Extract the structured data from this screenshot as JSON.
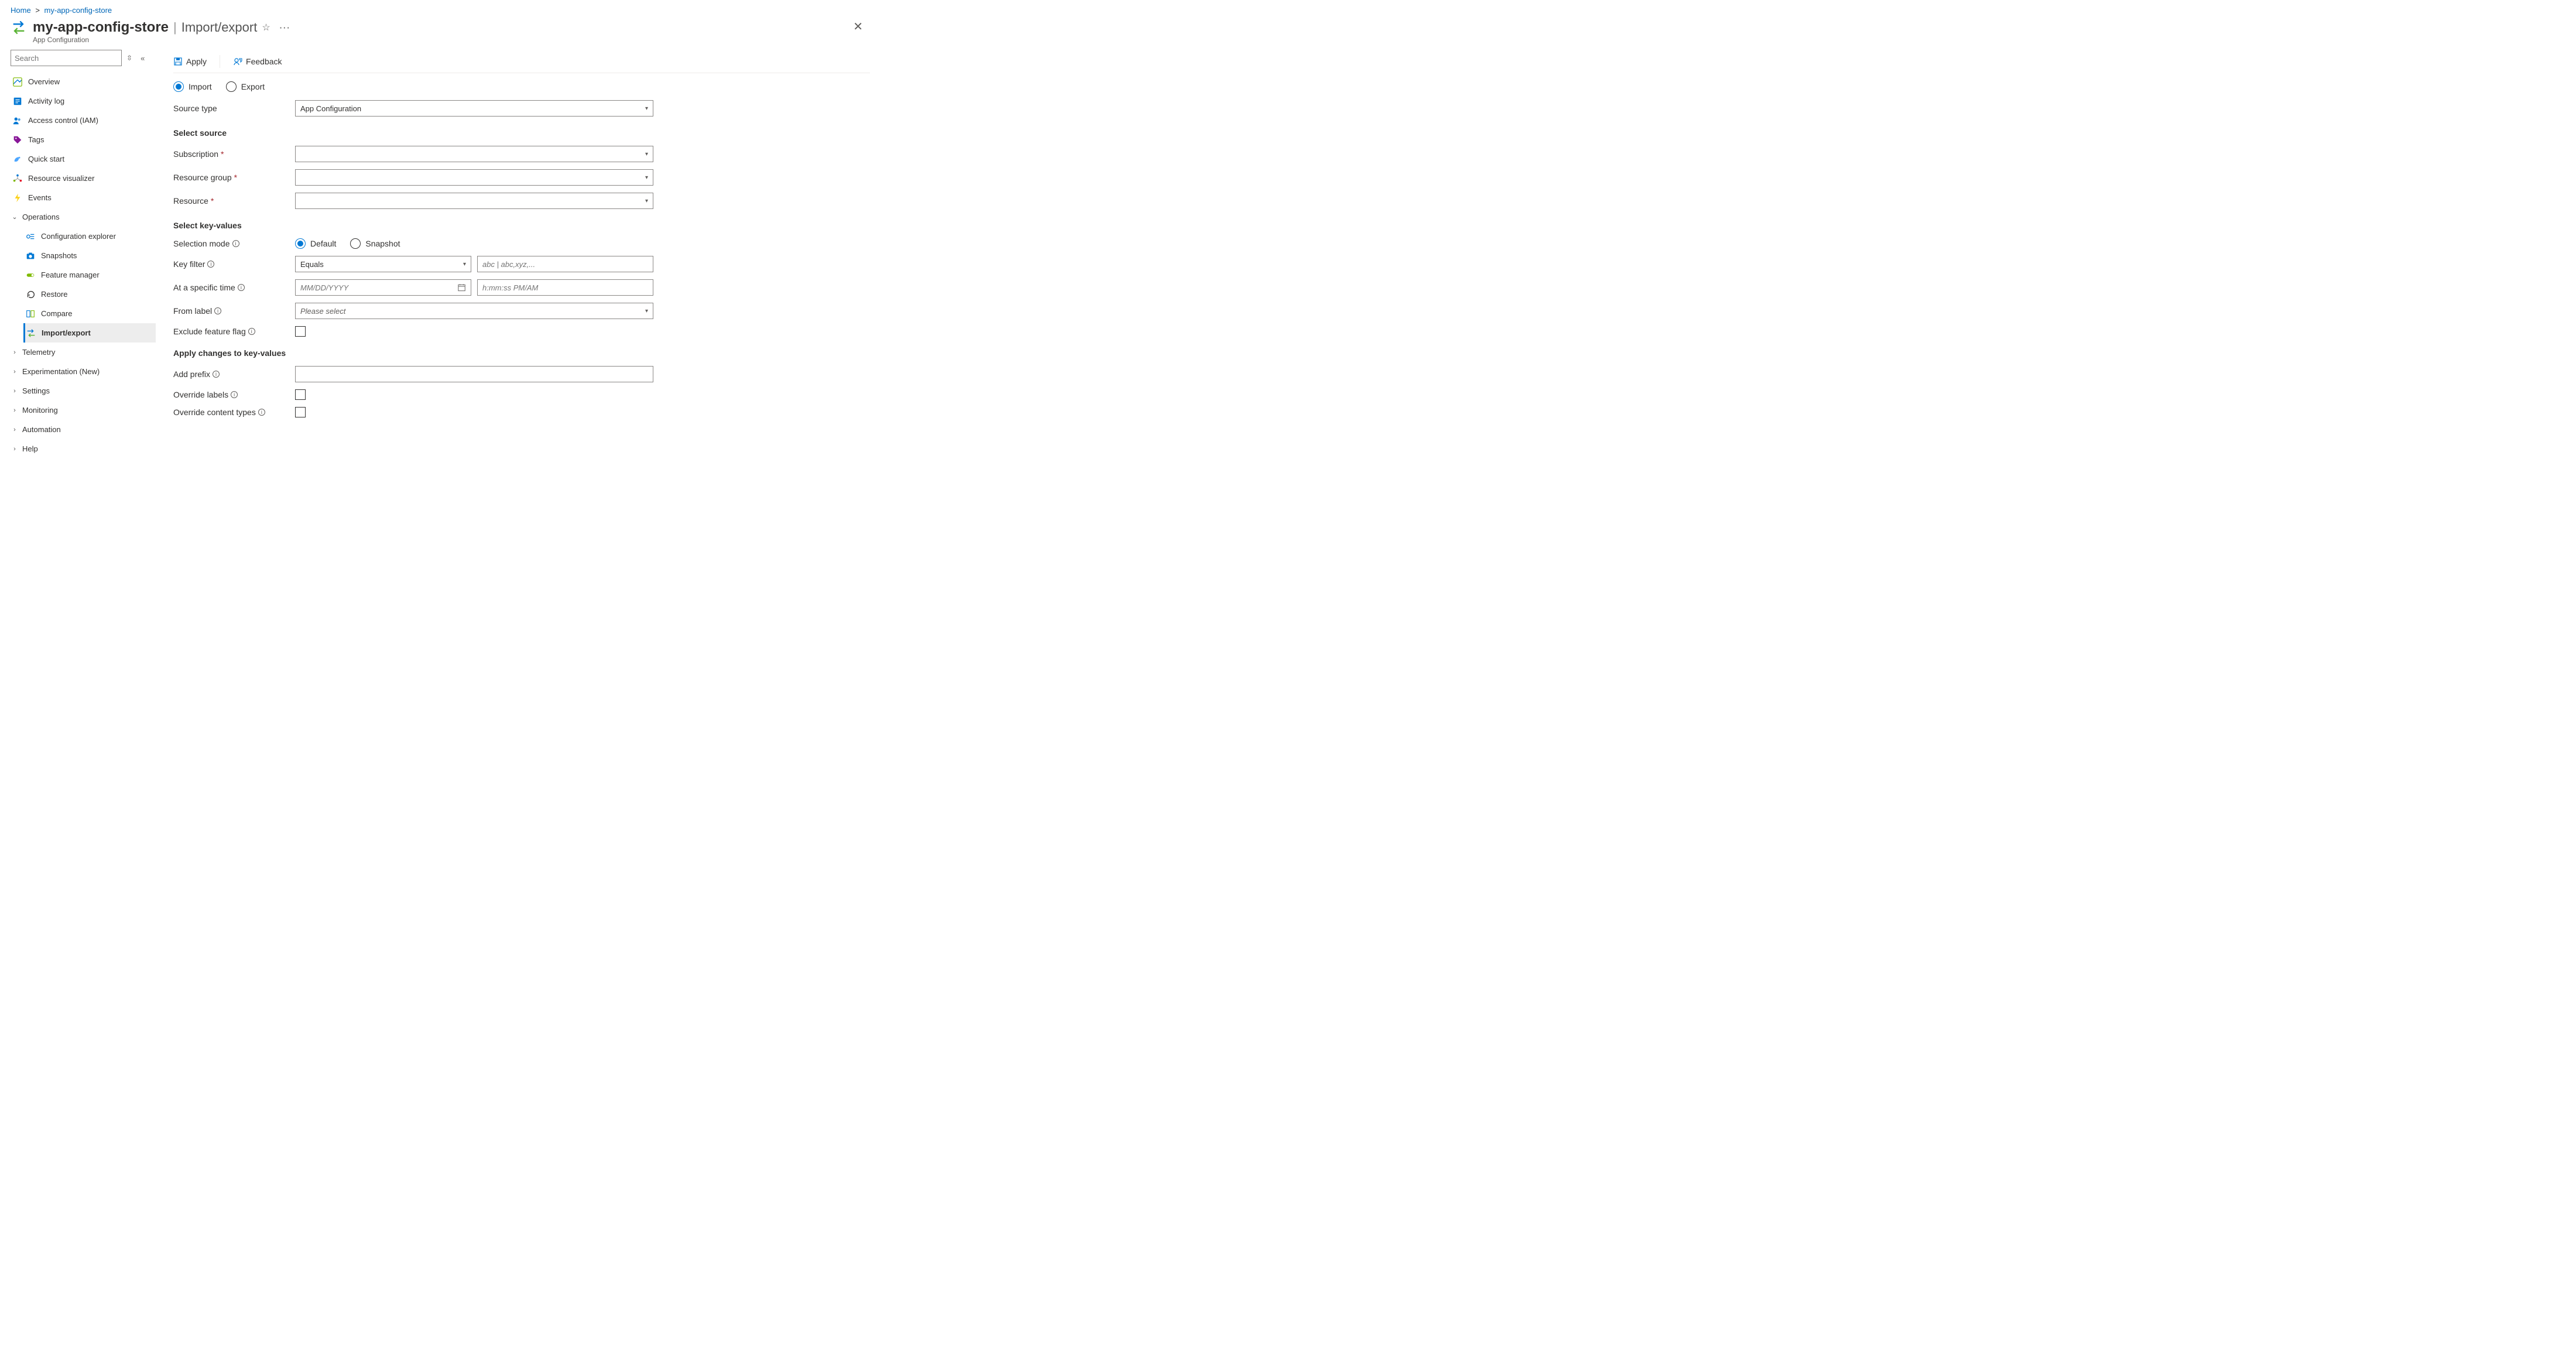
{
  "breadcrumb": {
    "home": "Home",
    "resource": "my-app-config-store"
  },
  "header": {
    "title": "my-app-config-store",
    "divider": "|",
    "page": "Import/export",
    "subtitle": "App Configuration",
    "star_aria": "Pin",
    "more_aria": "More",
    "close_aria": "Close"
  },
  "sidebar": {
    "search_placeholder": "Search",
    "items_top": [
      {
        "key": "overview",
        "label": "Overview"
      },
      {
        "key": "activity-log",
        "label": "Activity log"
      },
      {
        "key": "access-control",
        "label": "Access control (IAM)"
      },
      {
        "key": "tags",
        "label": "Tags"
      },
      {
        "key": "quick-start",
        "label": "Quick start"
      },
      {
        "key": "resource-visualizer",
        "label": "Resource visualizer"
      },
      {
        "key": "events",
        "label": "Events"
      }
    ],
    "operations": {
      "label": "Operations",
      "items": [
        {
          "key": "configuration-explorer",
          "label": "Configuration explorer"
        },
        {
          "key": "snapshots",
          "label": "Snapshots"
        },
        {
          "key": "feature-manager",
          "label": "Feature manager"
        },
        {
          "key": "restore",
          "label": "Restore"
        },
        {
          "key": "compare",
          "label": "Compare"
        },
        {
          "key": "import-export",
          "label": "Import/export",
          "active": true
        }
      ]
    },
    "groups_collapsed": [
      "Telemetry",
      "Experimentation (New)",
      "Settings",
      "Monitoring",
      "Automation",
      "Help"
    ]
  },
  "cmd": {
    "apply": "Apply",
    "feedback": "Feedback"
  },
  "form": {
    "mode_import": "Import",
    "mode_export": "Export",
    "source_type_label": "Source type",
    "source_type_value": "App Configuration",
    "section_select_source": "Select source",
    "subscription_label": "Subscription",
    "resource_group_label": "Resource group",
    "resource_label": "Resource",
    "section_select_kv": "Select key-values",
    "selection_mode_label": "Selection mode",
    "selection_mode_default": "Default",
    "selection_mode_snapshot": "Snapshot",
    "key_filter_label": "Key filter",
    "key_filter_op": "Equals",
    "key_filter_placeholder": "abc | abc,xyz,...",
    "at_time_label": "At a specific time",
    "date_placeholder": "MM/DD/YYYY",
    "time_placeholder": "h:mm:ss PM/AM",
    "from_label_label": "From label",
    "from_label_placeholder": "Please select",
    "exclude_ff_label": "Exclude feature flag",
    "section_apply_changes": "Apply changes to key-values",
    "add_prefix_label": "Add prefix",
    "override_labels_label": "Override labels",
    "override_ct_label": "Override content types"
  }
}
